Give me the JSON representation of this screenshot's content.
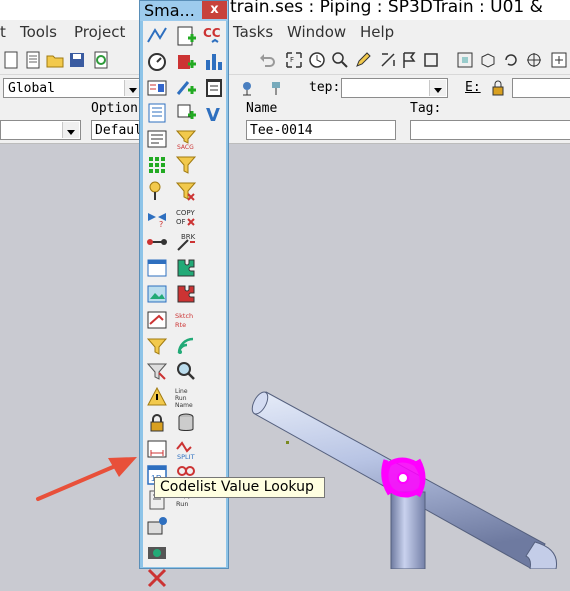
{
  "window": {
    "title": "train.ses : Piping : SP3DTrain : U01 &"
  },
  "menu": [
    "t",
    "Tools",
    "Project",
    "Tasks",
    "Window",
    "Help"
  ],
  "toolbar2": {
    "filter_value": "Global",
    "step_label": "tep:",
    "step_value": "",
    "e_label": "E:"
  },
  "toolbar3": {
    "option_label": "Option",
    "option_value": "Defaul",
    "name_label": "Name",
    "name_value": "Tee-0014",
    "tag_label": "Tag:",
    "tag_value": ""
  },
  "palette": {
    "title": "Sma...",
    "close_glyph": "x",
    "left_icons": [
      "route-icon",
      "measure-icon",
      "properties-icon",
      "list-icon",
      "report-icon",
      "grid-icon",
      "pin-icon",
      "valve-icon",
      "connection-icon",
      "window-icon",
      "picture-icon",
      "draw-icon",
      "filter-icon",
      "hammer-icon",
      "warning-icon",
      "lock-icon",
      "dimension-icon",
      "codelist-icon",
      "book-icon",
      "mirror-icon",
      "camera-icon",
      "cross-icon"
    ],
    "right_icons": [
      "add-document-icon",
      "add-red-icon",
      "add-blue-icon",
      "add-green-icon",
      "filter-sort-icon",
      "filter-yellow-icon",
      "filter-x-icon",
      "copy-of-icon",
      "brk-icon",
      "puzzle-icon",
      "puzzle-red-icon",
      "sketch-icon",
      "signal-icon",
      "search-icon",
      "line-run-icon",
      "database-icon",
      "split-icon",
      "join-icon",
      "copy-run-icon"
    ],
    "third_icons": [
      "cc-icon",
      "chart-icon",
      "clipboard-icon",
      "v-icon"
    ]
  },
  "tooltip": {
    "text": "Codelist Value Lookup"
  },
  "colors": {
    "pipe": "#b8c4e4",
    "highlight": "#ff00ff",
    "arrow": "#e8503a"
  }
}
